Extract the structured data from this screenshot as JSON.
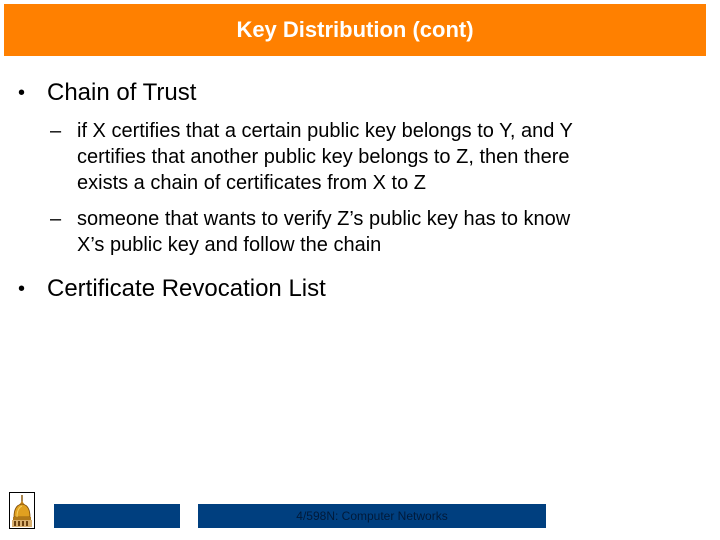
{
  "slide": {
    "title": "Key Distribution (cont)",
    "colors": {
      "title_bar": "#FF8000",
      "title_text": "#FFFFFF",
      "footer_bar": "#003F7F"
    },
    "bullets": [
      {
        "marker": "•",
        "text": "Chain of Trust",
        "sub_items": [
          {
            "marker": "–",
            "lines": [
              "if X certifies that a certain public key belongs to Y, and Y",
              "certifies that another public key belongs to Z, then there",
              "exists a chain of certificates from X to Z"
            ]
          },
          {
            "marker": "–",
            "lines": [
              "someone that wants to verify Z’s public key has to know",
              "X’s public key and follow the chain"
            ]
          }
        ]
      },
      {
        "marker": "•",
        "text": "Certificate Revocation List",
        "sub_items": []
      }
    ],
    "footer": {
      "logo_icon": "golden-dome-icon",
      "left_bar_text": "",
      "course_text": "4/598N: Computer Networks"
    }
  }
}
